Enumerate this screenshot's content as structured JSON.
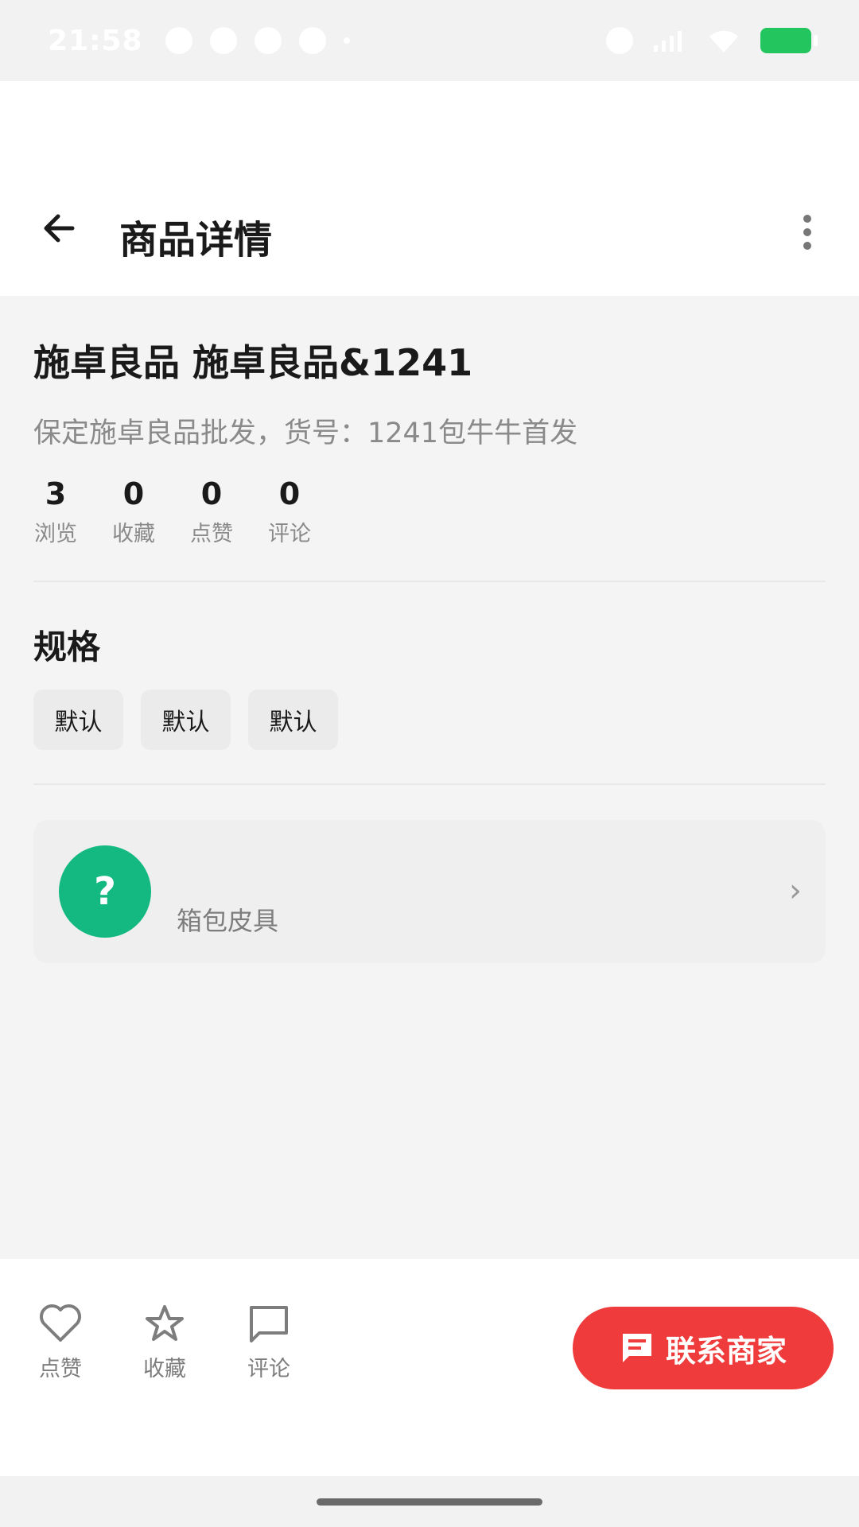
{
  "status_bar": {
    "time": "21:58"
  },
  "header": {
    "title": "商品详情",
    "back_icon": "arrow-left-icon",
    "more_icon": "more-vertical-icon"
  },
  "product": {
    "title": "施卓良品 施卓良品&1241",
    "description": "保定施卓良品批发，货号：1241包牛牛首发",
    "stats": [
      {
        "value": "3",
        "label": "浏览"
      },
      {
        "value": "0",
        "label": "收藏"
      },
      {
        "value": "0",
        "label": "点赞"
      },
      {
        "value": "0",
        "label": "评论"
      }
    ]
  },
  "specs": {
    "title": "规格",
    "options": [
      "默认",
      "默认",
      "默认"
    ]
  },
  "category": {
    "icon_text": "?",
    "name": "箱包皮具",
    "chevron": "›",
    "icon_color": "#13b981"
  },
  "bottom_bar": {
    "actions": [
      {
        "label": "点赞",
        "icon": "heart-icon"
      },
      {
        "label": "收藏",
        "icon": "star-icon"
      },
      {
        "label": "评论",
        "icon": "comment-icon"
      }
    ],
    "contact_label": "联系商家",
    "contact_color": "#ef3b3b"
  }
}
